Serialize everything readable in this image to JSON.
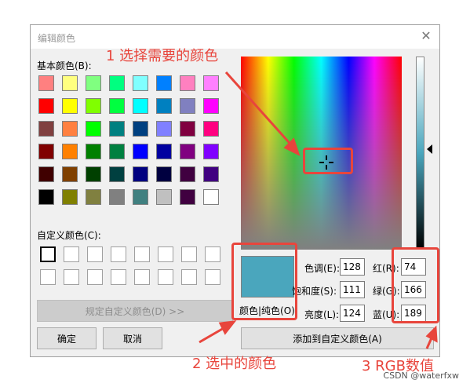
{
  "dialog": {
    "title": "编辑颜色",
    "basic_label": "基本颜色(B):",
    "custom_label": "自定义颜色(C):",
    "define_button": "规定自定义颜色(D) >>",
    "ok_button": "确定",
    "cancel_button": "取消",
    "color_solid_label": "颜色|纯色(O)",
    "add_button": "添加到自定义颜色(A)",
    "hue_label": "色调(E):",
    "hue_value": "128",
    "sat_label": "饱和度(S):",
    "sat_value": "111",
    "lum_label": "亮度(L):",
    "lum_value": "124",
    "red_label": "红(R):",
    "red_value": "74",
    "green_label": "绿(G):",
    "green_value": "166",
    "blue_label": "蓝(U):",
    "blue_value": "189",
    "selected_color": "#4aa6bd"
  },
  "basic_colors": [
    [
      "#ff8080",
      "#ffff80",
      "#80ff80",
      "#00ff80",
      "#80ffff",
      "#0080ff",
      "#ff80c0",
      "#ff80ff"
    ],
    [
      "#ff0000",
      "#ffff00",
      "#80ff00",
      "#00ff40",
      "#00ffff",
      "#0080c0",
      "#8080c0",
      "#ff00ff"
    ],
    [
      "#804040",
      "#ff8040",
      "#00ff00",
      "#008080",
      "#004080",
      "#8080ff",
      "#800040",
      "#ff0080"
    ],
    [
      "#800000",
      "#ff8000",
      "#008000",
      "#008040",
      "#0000ff",
      "#0000a0",
      "#800080",
      "#8000ff"
    ],
    [
      "#400000",
      "#804000",
      "#004000",
      "#004040",
      "#000080",
      "#000040",
      "#400040",
      "#400080"
    ],
    [
      "#000000",
      "#808000",
      "#808040",
      "#808080",
      "#408080",
      "#c0c0c0",
      "#400040",
      "#ffffff"
    ]
  ],
  "annotations": {
    "a1": "1 选择需要的颜色",
    "a2": "2 选中的颜色",
    "a3": "3 RGB数值",
    "accent": "#e8453c"
  },
  "watermark": "CSDN @waterfxw"
}
